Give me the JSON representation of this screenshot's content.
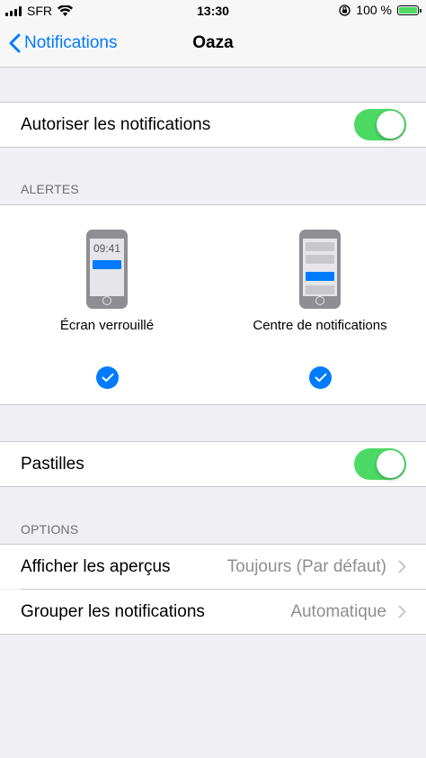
{
  "status_bar": {
    "carrier": "SFR",
    "time": "13:30",
    "battery": "100 %"
  },
  "nav": {
    "back_label": "Notifications",
    "title": "Oaza"
  },
  "allow_notifications": {
    "label": "Autoriser les notifications",
    "on": true
  },
  "alerts": {
    "header": "ALERTES",
    "lock_screen": {
      "time": "09:41",
      "label": "Écran verrouillé",
      "checked": true
    },
    "notification_center": {
      "label": "Centre de notifications",
      "checked": true
    }
  },
  "badges": {
    "label": "Pastilles",
    "on": true
  },
  "options": {
    "header": "OPTIONS",
    "rows": [
      {
        "label": "Afficher les aperçus",
        "value": "Toujours (Par défaut)"
      },
      {
        "label": "Grouper les notifications",
        "value": "Automatique"
      }
    ]
  },
  "colors": {
    "accent": "#007aff",
    "toggle_on": "#4cd964",
    "background": "#efeff4"
  }
}
